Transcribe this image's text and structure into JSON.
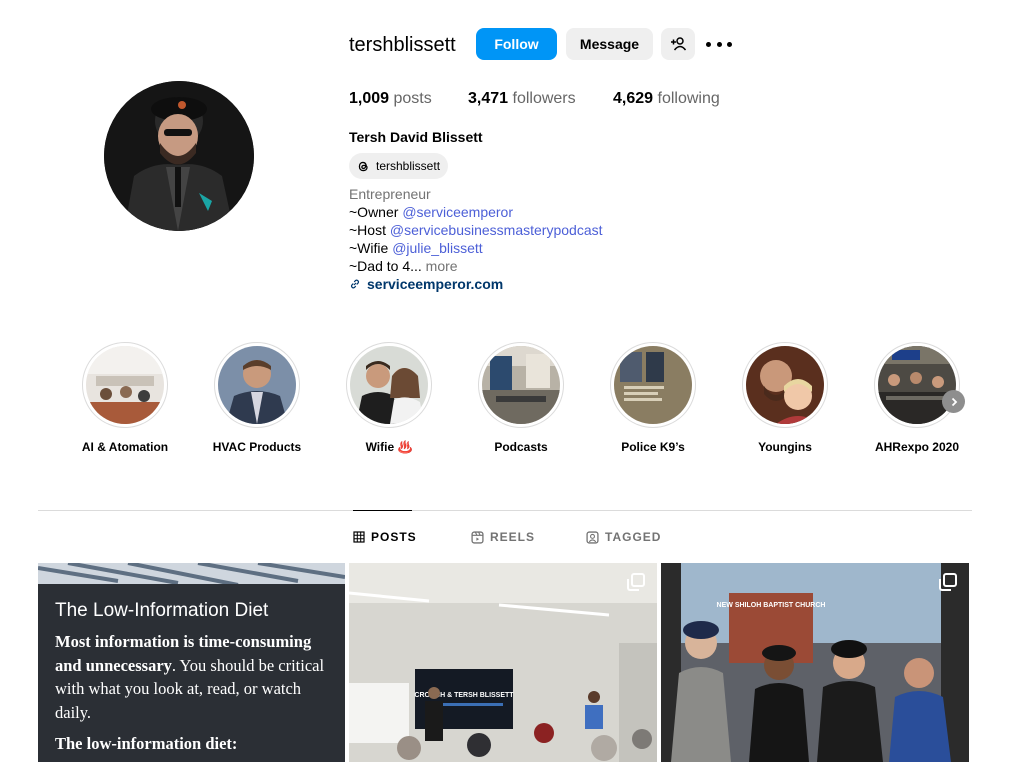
{
  "profile": {
    "username": "tershblissett",
    "follow_label": "Follow",
    "message_label": "Message",
    "posts_count": "1,009",
    "posts_label": "posts",
    "followers_count": "3,471",
    "followers_label": "followers",
    "following_count": "4,629",
    "following_label": "following",
    "full_name": "Tersh David Blissett",
    "threads_handle": "tershblissett",
    "category": "Entrepreneur",
    "bio_lines": [
      {
        "prefix": "~Owner ",
        "mention": "@serviceemperor"
      },
      {
        "prefix": "~Host ",
        "mention": "@servicebusinessmasterypodcast"
      },
      {
        "prefix": "~Wifie ",
        "mention": "@julie_blissett"
      },
      {
        "prefix": "~Dad to 4...",
        "more": "more"
      }
    ],
    "website": "serviceemperor.com"
  },
  "highlights": [
    {
      "label": "AI & Atomation"
    },
    {
      "label": "HVAC Products"
    },
    {
      "label": "Wifie ♨️"
    },
    {
      "label": "Podcasts"
    },
    {
      "label": "Police K9’s"
    },
    {
      "label": "Youngins"
    },
    {
      "label": "AHRexpo 2020"
    }
  ],
  "tabs": [
    {
      "label": "POSTS",
      "active": true
    },
    {
      "label": "REELS",
      "active": false
    },
    {
      "label": "TAGGED",
      "active": false
    }
  ],
  "posts": {
    "post1": {
      "title": "The Low-Information Diet",
      "body_bold": "Most information is time-consuming and unnecessary",
      "body_rest": ". You should be critical with what you look at, read, or watch daily.",
      "sub": "The low-information diet:"
    },
    "post2": {
      "screen_text": "CROUCH & TERSH BLISSETT"
    },
    "post3": {
      "sign_text": "NEW SHILOH BAPTIST CHURCH"
    }
  },
  "colors": {
    "accent": "#0095f6",
    "mention": "#4c5fd7",
    "link": "#00376b",
    "muted": "#737373"
  }
}
